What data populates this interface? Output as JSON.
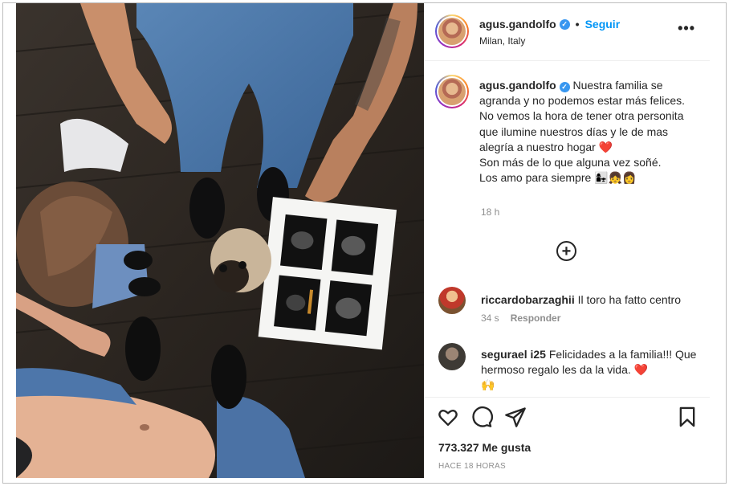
{
  "header": {
    "username": "agus.gandolfo",
    "verified_mark": "✓",
    "separator": "•",
    "follow_label": "Seguir",
    "location": "Milan, Italy",
    "more_label": "•••"
  },
  "caption": {
    "username": "agus.gandolfo",
    "text_1": "Nuestra familia se agranda y no podemos estar más felices. No vemos la hora de tener otra personita que ilumine nuestros días y le de mas alegría a nuestro hogar",
    "emoji_1": "❤️",
    "text_2": "Son más de lo que alguna vez soñé.",
    "text_3": "Los amo para siempre",
    "emoji_2": "👩‍👧👧👩",
    "time": "18 h"
  },
  "load_more_label": "+",
  "comments": [
    {
      "username": "riccardobarzaghii",
      "text": "Il toro ha fatto centro",
      "time": "34 s",
      "reply_label": "Responder"
    },
    {
      "username": "segurael i25",
      "text": "Felicidades a la familia!!! Que hermoso regalo les da la vida.",
      "emoji_1": "❤️",
      "emoji_2": "🙌"
    }
  ],
  "stats": {
    "likes": "773.327 Me gusta",
    "posted": "HACE 18 HORAS"
  },
  "icons": {
    "like": "heart-outline-icon",
    "comment": "comment-bubble-icon",
    "share": "paper-plane-icon",
    "save": "bookmark-icon"
  },
  "colors": {
    "link": "#0095f6",
    "verified": "#3897f0",
    "heart": "#ed4956",
    "muted": "#8e8e8e"
  }
}
